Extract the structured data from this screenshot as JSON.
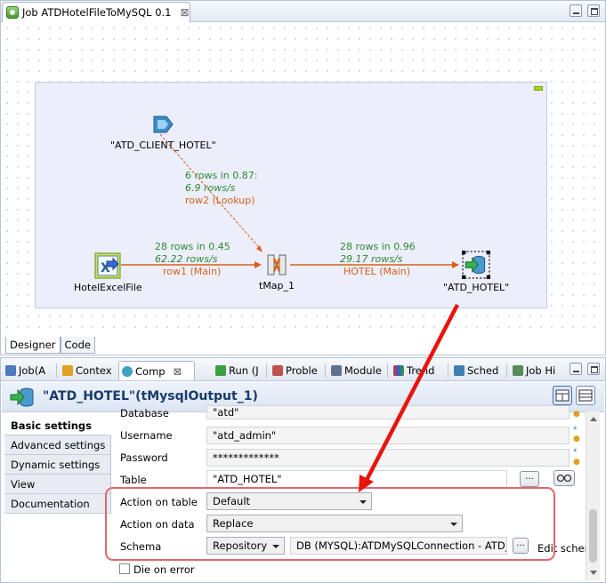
{
  "editor": {
    "tab_title": "Job ATDHotelFileToMySQL 0.1",
    "tab_close": "⊠",
    "bottom_tabs": [
      "Designer",
      "Code"
    ]
  },
  "canvas": {
    "components": [
      {
        "label": "\"ATD_CLIENT_HOTEL\""
      },
      {
        "label": "HotelExcelFile"
      },
      {
        "label": "tMap_1"
      },
      {
        "label": "\"ATD_HOTEL\""
      }
    ],
    "flows": [
      {
        "rows": "6 rows in 0.87:",
        "rate": "6.9 rows/s",
        "name": "row2 (Lookup)"
      },
      {
        "rows": "28 rows in 0.45",
        "rate": "62.22 rows/s",
        "name": "row1 (Main)"
      },
      {
        "rows": "28 rows in 0.96",
        "rate": "29.17 rows/s",
        "name": "HOTEL (Main)"
      }
    ]
  },
  "views": {
    "tabs": [
      {
        "label": "Job(A"
      },
      {
        "label": "Contex"
      },
      {
        "label": "Comp"
      },
      {
        "label": "Run (J"
      },
      {
        "label": "Proble"
      },
      {
        "label": "Module"
      },
      {
        "label": "Trend"
      },
      {
        "label": "Sched"
      },
      {
        "label": "Job Hi"
      }
    ],
    "close": "⊠"
  },
  "component_panel": {
    "title": "\"ATD_HOTEL\"(tMysqlOutput_1)",
    "sidebar": [
      "Basic settings",
      "Advanced settings",
      "Dynamic settings",
      "View",
      "Documentation"
    ],
    "fields": {
      "database_label": "Database",
      "database_value": "\"atd\"",
      "username_label": "Username",
      "username_value": "\"atd_admin\"",
      "password_label": "Password",
      "password_value": "*************",
      "table_label": "Table",
      "table_value": "\"ATD_HOTEL\"",
      "table_btn": "...",
      "action_table_label": "Action on table",
      "action_table_value": "Default",
      "action_data_label": "Action on data",
      "action_data_value": "Replace",
      "schema_label": "Schema",
      "schema_type": "Repository",
      "schema_value": "DB (MYSQL):ATDMySQLConnection - ATD_H",
      "schema_btn": "...",
      "edit_schema": "Edit schem",
      "die_on_error": "Die on error"
    }
  },
  "colors": {
    "flow": "#d86018",
    "stats": "#2e8a2e",
    "highlight": "#e06870",
    "arrow": "#e8140a"
  }
}
